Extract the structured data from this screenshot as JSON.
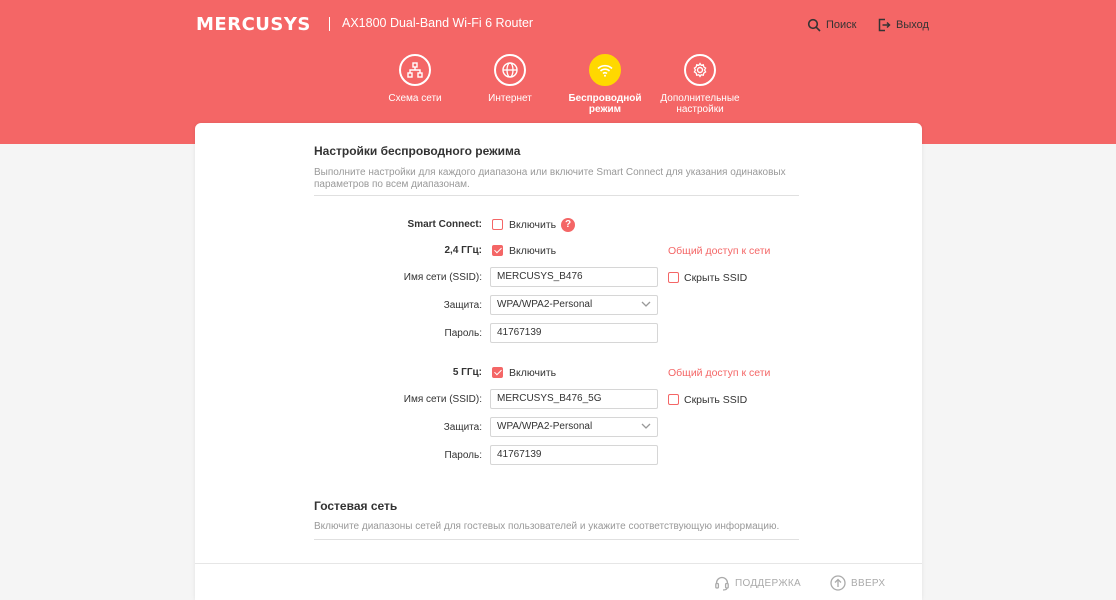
{
  "header": {
    "logo": "MERCUSYS",
    "model": "AX1800 Dual-Band Wi-Fi 6 Router",
    "search_label": "Поиск",
    "logout_label": "Выход",
    "bg_color": "#f46666"
  },
  "nav": {
    "items": [
      {
        "label": "Схема сети",
        "icon": "network-map-icon"
      },
      {
        "label": "Интернет",
        "icon": "globe-icon"
      },
      {
        "label": "Беспроводной режим",
        "icon": "wifi-icon",
        "active": true
      },
      {
        "label": "Дополнительные настройки",
        "icon": "gear-icon"
      }
    ],
    "active_color": "#ffd800"
  },
  "wireless": {
    "title": "Настройки беспроводного режима",
    "desc": "Выполните настройки для каждого диапазона или включите Smart Connect для указания одинаковых параметров по всем диапазонам.",
    "smart_connect_label": "Smart Connect:",
    "enable_label": "Включить",
    "smart_connect_checked": false,
    "help_symbol": "?",
    "band24": {
      "label": "2,4 ГГц:",
      "enabled": true,
      "share_link": "Общий доступ к сети",
      "ssid_label": "Имя сети (SSID):",
      "ssid": "MERCUSYS_B476",
      "hide_ssid_label": "Скрыть SSID",
      "hide_ssid": false,
      "security_label": "Защита:",
      "security": "WPA/WPA2-Personal",
      "password_label": "Пароль:",
      "password": "41767139"
    },
    "band5": {
      "label": "5 ГГц:",
      "enabled": true,
      "share_link": "Общий доступ к сети",
      "ssid_label": "Имя сети (SSID):",
      "ssid": "MERCUSYS_B476_5G",
      "hide_ssid_label": "Скрыть SSID",
      "hide_ssid": false,
      "security_label": "Защита:",
      "security": "WPA/WPA2-Personal",
      "password_label": "Пароль:",
      "password": "41767139"
    }
  },
  "guest": {
    "title": "Гостевая сеть",
    "desc": "Включите диапазоны сетей для гостевых пользователей и укажите соответствующую информацию."
  },
  "footer": {
    "support_label": "ПОДДЕРЖКА",
    "top_label": "ВВЕРХ"
  }
}
